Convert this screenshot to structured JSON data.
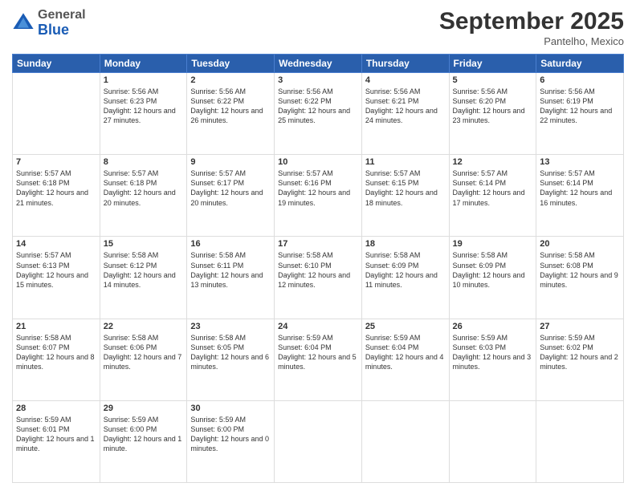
{
  "header": {
    "logo_general": "General",
    "logo_blue": "Blue",
    "month_title": "September 2025",
    "location": "Pantelho, Mexico"
  },
  "weekdays": [
    "Sunday",
    "Monday",
    "Tuesday",
    "Wednesday",
    "Thursday",
    "Friday",
    "Saturday"
  ],
  "weeks": [
    [
      {
        "day": "",
        "info": ""
      },
      {
        "day": "1",
        "info": "Sunrise: 5:56 AM\nSunset: 6:23 PM\nDaylight: 12 hours\nand 27 minutes."
      },
      {
        "day": "2",
        "info": "Sunrise: 5:56 AM\nSunset: 6:22 PM\nDaylight: 12 hours\nand 26 minutes."
      },
      {
        "day": "3",
        "info": "Sunrise: 5:56 AM\nSunset: 6:22 PM\nDaylight: 12 hours\nand 25 minutes."
      },
      {
        "day": "4",
        "info": "Sunrise: 5:56 AM\nSunset: 6:21 PM\nDaylight: 12 hours\nand 24 minutes."
      },
      {
        "day": "5",
        "info": "Sunrise: 5:56 AM\nSunset: 6:20 PM\nDaylight: 12 hours\nand 23 minutes."
      },
      {
        "day": "6",
        "info": "Sunrise: 5:56 AM\nSunset: 6:19 PM\nDaylight: 12 hours\nand 22 minutes."
      }
    ],
    [
      {
        "day": "7",
        "info": "Sunrise: 5:57 AM\nSunset: 6:18 PM\nDaylight: 12 hours\nand 21 minutes."
      },
      {
        "day": "8",
        "info": "Sunrise: 5:57 AM\nSunset: 6:18 PM\nDaylight: 12 hours\nand 20 minutes."
      },
      {
        "day": "9",
        "info": "Sunrise: 5:57 AM\nSunset: 6:17 PM\nDaylight: 12 hours\nand 20 minutes."
      },
      {
        "day": "10",
        "info": "Sunrise: 5:57 AM\nSunset: 6:16 PM\nDaylight: 12 hours\nand 19 minutes."
      },
      {
        "day": "11",
        "info": "Sunrise: 5:57 AM\nSunset: 6:15 PM\nDaylight: 12 hours\nand 18 minutes."
      },
      {
        "day": "12",
        "info": "Sunrise: 5:57 AM\nSunset: 6:14 PM\nDaylight: 12 hours\nand 17 minutes."
      },
      {
        "day": "13",
        "info": "Sunrise: 5:57 AM\nSunset: 6:14 PM\nDaylight: 12 hours\nand 16 minutes."
      }
    ],
    [
      {
        "day": "14",
        "info": "Sunrise: 5:57 AM\nSunset: 6:13 PM\nDaylight: 12 hours\nand 15 minutes."
      },
      {
        "day": "15",
        "info": "Sunrise: 5:58 AM\nSunset: 6:12 PM\nDaylight: 12 hours\nand 14 minutes."
      },
      {
        "day": "16",
        "info": "Sunrise: 5:58 AM\nSunset: 6:11 PM\nDaylight: 12 hours\nand 13 minutes."
      },
      {
        "day": "17",
        "info": "Sunrise: 5:58 AM\nSunset: 6:10 PM\nDaylight: 12 hours\nand 12 minutes."
      },
      {
        "day": "18",
        "info": "Sunrise: 5:58 AM\nSunset: 6:09 PM\nDaylight: 12 hours\nand 11 minutes."
      },
      {
        "day": "19",
        "info": "Sunrise: 5:58 AM\nSunset: 6:09 PM\nDaylight: 12 hours\nand 10 minutes."
      },
      {
        "day": "20",
        "info": "Sunrise: 5:58 AM\nSunset: 6:08 PM\nDaylight: 12 hours\nand 9 minutes."
      }
    ],
    [
      {
        "day": "21",
        "info": "Sunrise: 5:58 AM\nSunset: 6:07 PM\nDaylight: 12 hours\nand 8 minutes."
      },
      {
        "day": "22",
        "info": "Sunrise: 5:58 AM\nSunset: 6:06 PM\nDaylight: 12 hours\nand 7 minutes."
      },
      {
        "day": "23",
        "info": "Sunrise: 5:58 AM\nSunset: 6:05 PM\nDaylight: 12 hours\nand 6 minutes."
      },
      {
        "day": "24",
        "info": "Sunrise: 5:59 AM\nSunset: 6:04 PM\nDaylight: 12 hours\nand 5 minutes."
      },
      {
        "day": "25",
        "info": "Sunrise: 5:59 AM\nSunset: 6:04 PM\nDaylight: 12 hours\nand 4 minutes."
      },
      {
        "day": "26",
        "info": "Sunrise: 5:59 AM\nSunset: 6:03 PM\nDaylight: 12 hours\nand 3 minutes."
      },
      {
        "day": "27",
        "info": "Sunrise: 5:59 AM\nSunset: 6:02 PM\nDaylight: 12 hours\nand 2 minutes."
      }
    ],
    [
      {
        "day": "28",
        "info": "Sunrise: 5:59 AM\nSunset: 6:01 PM\nDaylight: 12 hours\nand 1 minute."
      },
      {
        "day": "29",
        "info": "Sunrise: 5:59 AM\nSunset: 6:00 PM\nDaylight: 12 hours\nand 1 minute."
      },
      {
        "day": "30",
        "info": "Sunrise: 5:59 AM\nSunset: 6:00 PM\nDaylight: 12 hours\nand 0 minutes."
      },
      {
        "day": "",
        "info": ""
      },
      {
        "day": "",
        "info": ""
      },
      {
        "day": "",
        "info": ""
      },
      {
        "day": "",
        "info": ""
      }
    ]
  ]
}
